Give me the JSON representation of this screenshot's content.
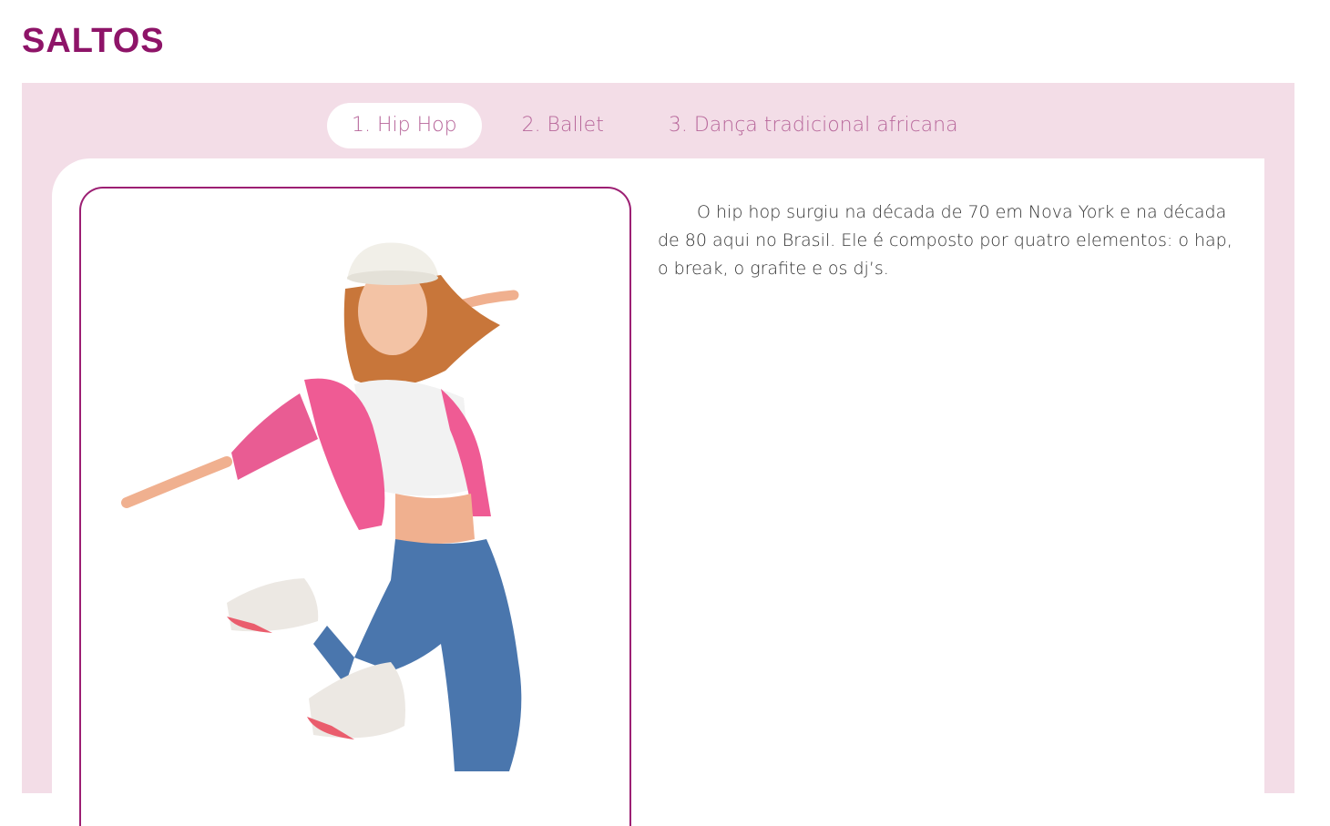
{
  "page": {
    "title": "SALTOS"
  },
  "tabs": [
    {
      "label": "1. Hip Hop",
      "active": true
    },
    {
      "label": "2. Ballet",
      "active": false
    },
    {
      "label": "3. Dança tradicional africana",
      "active": false
    }
  ],
  "content": {
    "image_subject": "jumping-hip-hop-dancer-photo",
    "description": "O hip hop surgiu na década de 70 em Nova York e na década de 80 aqui no Brasil. Ele é composto por quatro elementos: o hap, o break, o grafite e os dj’s."
  },
  "colors": {
    "title": "#8e1468",
    "panel_bg": "#f3dde7",
    "tab_text": "#b7669a",
    "frame_border": "#9c1f73",
    "body_text": "#333333"
  }
}
